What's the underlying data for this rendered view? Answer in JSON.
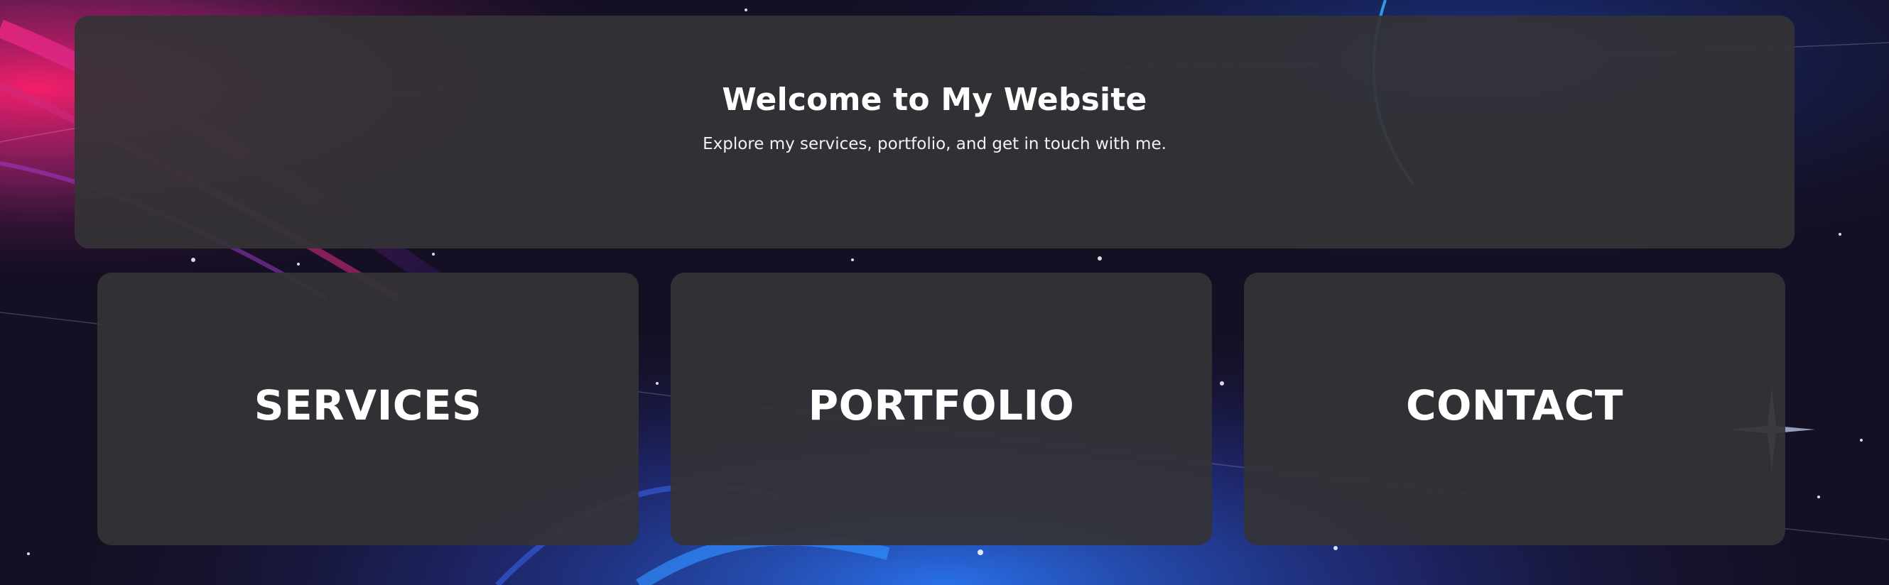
{
  "header": {
    "title": "Welcome to My Website",
    "subtitle": "Explore my services, portfolio, and get in touch with me."
  },
  "cards": [
    {
      "label": "SERVICES"
    },
    {
      "label": "PORTFOLIO"
    },
    {
      "label": "CONTACT"
    }
  ],
  "colors": {
    "panel": "#343336",
    "text": "#ffffff",
    "accent_pink": "#ff2a8a",
    "accent_blue": "#1f8bff",
    "background": "#140f22"
  }
}
